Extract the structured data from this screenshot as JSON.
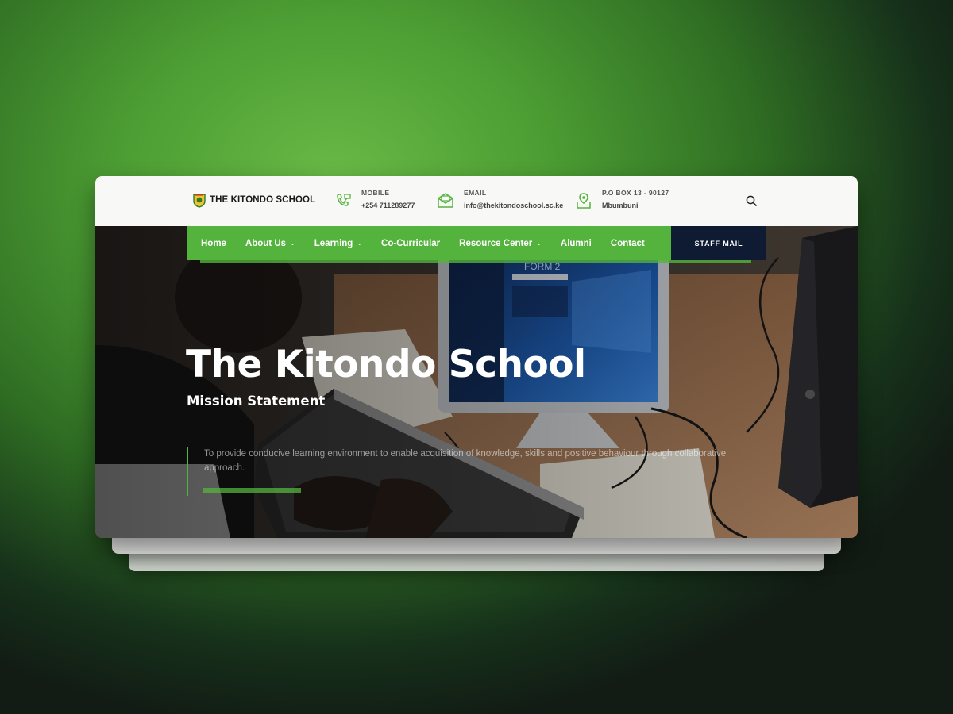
{
  "site": {
    "logo_text": "THE KITONDO SCHOOL"
  },
  "contact": {
    "mobile_label": "MOBILE",
    "mobile_value": "+254 711289277",
    "email_label": "EMAIL",
    "email_value": "info@thekitondoschool.sc.ke",
    "address_label": "P.O BOX 13 - 90127",
    "address_value": "Mbumbuni"
  },
  "nav": {
    "items": [
      {
        "label": "Home",
        "dropdown": false
      },
      {
        "label": "About Us",
        "dropdown": true
      },
      {
        "label": "Learning",
        "dropdown": true
      },
      {
        "label": "Co-Curricular",
        "dropdown": false
      },
      {
        "label": "Resource Center",
        "dropdown": true
      },
      {
        "label": "Alumni",
        "dropdown": false
      },
      {
        "label": "Contact",
        "dropdown": false
      }
    ],
    "staff_mail": "STAFF MAIL"
  },
  "hero": {
    "title": "The Kitondo School",
    "subtitle": "Mission Statement",
    "mission_text": "To provide conducive learning environment to enable acquisition of knowledge, skills and positive behaviour through collaborative approach.",
    "screen_text": "FORM 2"
  },
  "colors": {
    "brand_green": "#54b33d",
    "staff_button": "#0f1a33",
    "background_green": "#4c9d33"
  }
}
